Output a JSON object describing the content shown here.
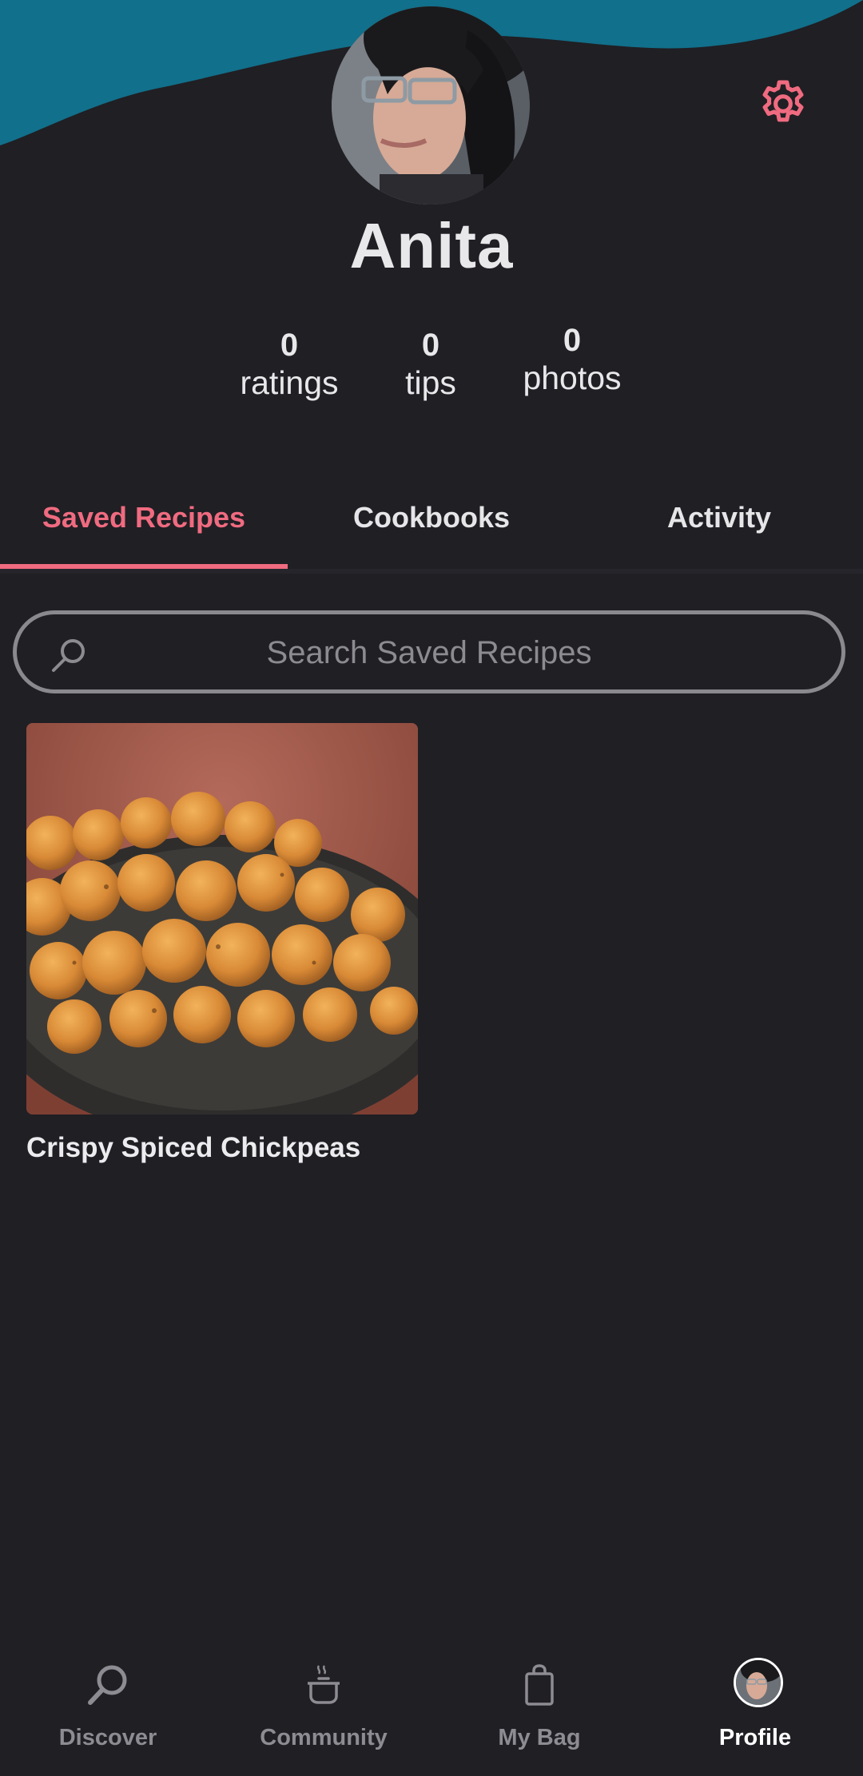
{
  "profile": {
    "name": "Anita",
    "stats": [
      {
        "value": "0",
        "label": "ratings"
      },
      {
        "value": "0",
        "label": "tips"
      },
      {
        "value": "0",
        "label": "photos"
      }
    ]
  },
  "tabs": [
    {
      "label": "Saved Recipes",
      "active": true
    },
    {
      "label": "Cookbooks",
      "active": false
    },
    {
      "label": "Activity",
      "active": false
    }
  ],
  "search": {
    "placeholder": "Search Saved Recipes",
    "value": ""
  },
  "recipes": [
    {
      "title": "Crispy Spiced Chickpeas",
      "image": "roasted-chickpeas-bowl"
    }
  ],
  "nav": [
    {
      "label": "Discover",
      "icon": "search-icon",
      "active": false
    },
    {
      "label": "Community",
      "icon": "pot-icon",
      "active": false
    },
    {
      "label": "My Bag",
      "icon": "bag-icon",
      "active": false
    },
    {
      "label": "Profile",
      "icon": "avatar",
      "active": true
    }
  ],
  "colors": {
    "background": "#201f24",
    "accent": "#f06b80",
    "header_wave": "#11708b",
    "muted": "#8d8c92"
  }
}
